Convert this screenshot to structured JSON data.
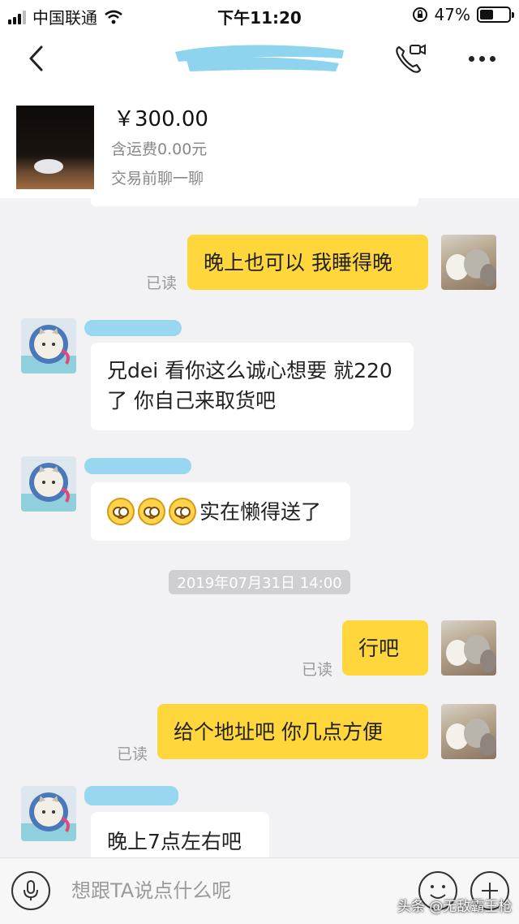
{
  "status_bar": {
    "carrier": "中国联通",
    "time": "下午11:20",
    "battery_percent": "47%",
    "battery_level": 0.47
  },
  "nav": {
    "title_redacted": true
  },
  "product": {
    "price": "￥300.00",
    "shipping": "含运费0.00元",
    "note": "交易前聊一聊"
  },
  "chat": {
    "messages": [
      {
        "from": "me",
        "text": "晚上也可以 我睡得晚",
        "read": "已读"
      },
      {
        "from": "them",
        "text": "兄dei  看你这么诚心想要    就220了  你自己来取货吧"
      },
      {
        "from": "them",
        "emoji_count": 3,
        "text": "实在懒得送了"
      },
      {
        "type": "timestamp",
        "text": "2019年07月31日 14:00"
      },
      {
        "from": "me",
        "text": "行吧",
        "read": "已读"
      },
      {
        "from": "me",
        "text": "给个地址吧 你几点方便",
        "read": "已读"
      },
      {
        "from": "them",
        "text": "晚上7点左右吧"
      }
    ]
  },
  "input": {
    "placeholder": "想跟TA说点什么呢"
  },
  "watermark": "头条 @无敌霸王枪",
  "colors": {
    "my_bubble": "#ffd73c",
    "their_bubble": "#ffffff",
    "background": "#f2f2f4",
    "name_redaction": "#8fd4ef"
  }
}
